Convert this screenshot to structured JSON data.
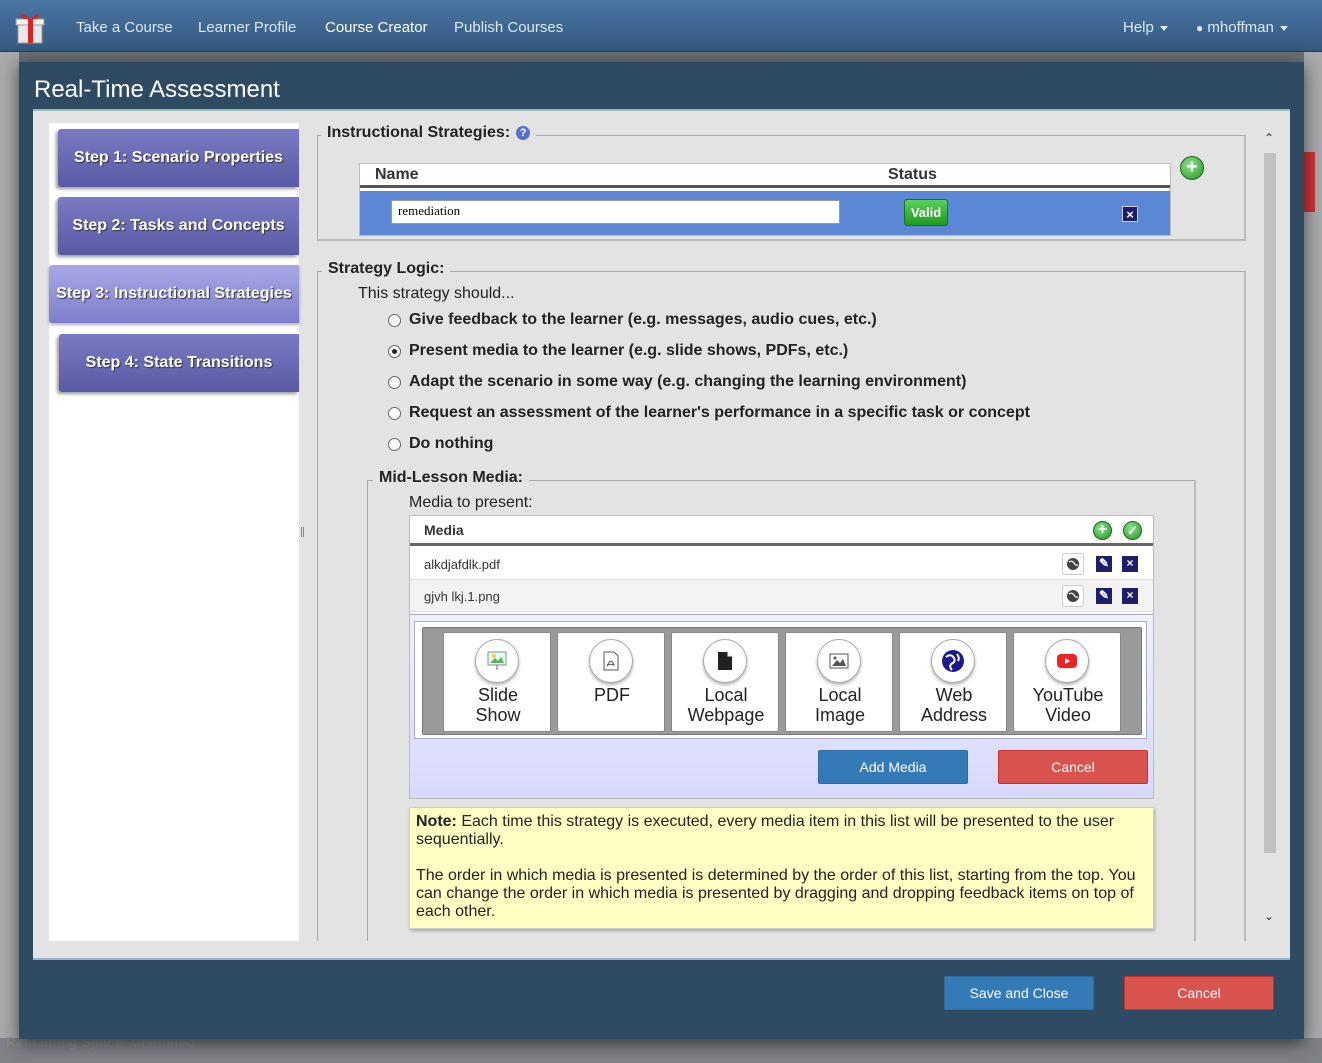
{
  "navbar": {
    "items": [
      "Take a Course",
      "Learner Profile",
      "Course Creator",
      "Publish Courses"
    ],
    "help_label": "Help",
    "user_label": "mhoffman"
  },
  "background": {
    "footer_text": "Remaining Space: Unlimited"
  },
  "modal": {
    "title": "Real-Time Assessment",
    "steps": [
      "Step 1: Scenario Properties",
      "Step 2: Tasks and Concepts",
      "Step 3: Instructional Strategies",
      "Step 4: State Transitions"
    ],
    "active_step": 3,
    "instructional_strategies": {
      "legend": "Instructional Strategies:",
      "help_icon": "?",
      "col_name": "Name",
      "col_status": "Status",
      "row": {
        "name": "remediation",
        "status": "Valid"
      }
    },
    "strategy_logic": {
      "legend": "Strategy Logic:",
      "intro": "This strategy should...",
      "options": [
        "Give feedback to the learner (e.g. messages, audio cues, etc.)",
        "Present media to the learner (e.g. slide shows, PDFs, etc.)",
        "Adapt the scenario in some way (e.g. changing the learning environment)",
        "Request an assessment of the learner's performance in a specific task or concept",
        "Do nothing"
      ],
      "selected_option": 1
    },
    "mid_lesson_media": {
      "legend": "Mid-Lesson Media:",
      "intro": "Media to present:",
      "header": "Media",
      "items": [
        "alkdjafdlk.pdf",
        "gjvh lkj.1.png"
      ],
      "media_types": [
        {
          "label1": "Slide",
          "label2": "Show",
          "icon": "slideshow-icon"
        },
        {
          "label1": "PDF",
          "label2": "",
          "icon": "pdf-icon"
        },
        {
          "label1": "Local",
          "label2": "Webpage",
          "icon": "local-webpage-icon"
        },
        {
          "label1": "Local",
          "label2": "Image",
          "icon": "local-image-icon"
        },
        {
          "label1": "Web",
          "label2": "Address",
          "icon": "globe-icon"
        },
        {
          "label1": "YouTube",
          "label2": "Video",
          "icon": "youtube-icon"
        }
      ],
      "add_media_label": "Add Media",
      "cancel_label": "Cancel"
    },
    "note": {
      "bold": "Note:",
      "text1": " Each time this strategy is executed, every media item in this list will be presented to the user sequentially.",
      "text2": "The order in which media is presented is determined by the order of this list, starting from the top. You can change the order in which media is presented by dragging and dropping feedback items on top of each other."
    },
    "footer": {
      "save_label": "Save and Close",
      "cancel_label": "Cancel"
    }
  },
  "colors": {
    "step_active": "#9d9de0",
    "step": "#6a6ab5",
    "modal_bg": "#2f4b64",
    "valid_green": "#2eaa2e"
  }
}
